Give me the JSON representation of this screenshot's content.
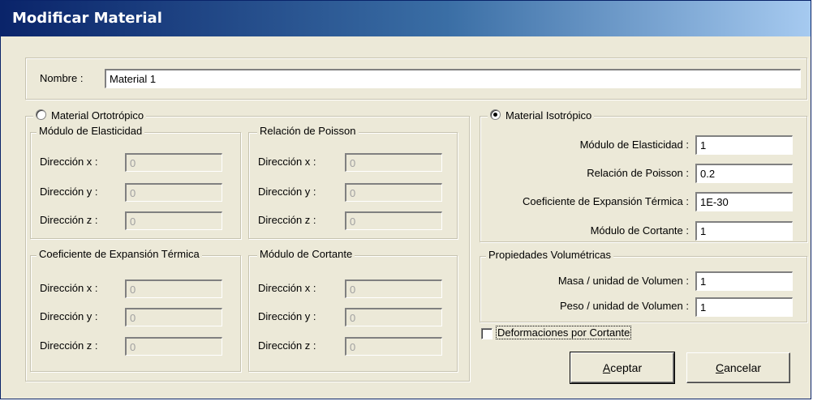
{
  "window": {
    "title": "Modificar Material"
  },
  "name": {
    "label": "Nombre :",
    "value": "Material 1"
  },
  "ortho": {
    "radio_label": "Material Ortotrópico",
    "selected": false,
    "modulus": {
      "title": "Módulo de Elasticidad",
      "x_label": "Dirección x :",
      "y_label": "Dirección y :",
      "z_label": "Dirección z :",
      "x": "0",
      "y": "0",
      "z": "0"
    },
    "poisson": {
      "title": "Relación de Poisson",
      "x_label": "Dirección x :",
      "y_label": "Dirección y :",
      "z_label": "Dirección z :",
      "x": "0",
      "y": "0",
      "z": "0"
    },
    "thermal": {
      "title": "Coeficiente de Expansión Térmica",
      "x_label": "Dirección x :",
      "y_label": "Dirección y :",
      "z_label": "Dirección z :",
      "x": "0",
      "y": "0",
      "z": "0"
    },
    "shear": {
      "title": "Módulo de Cortante",
      "x_label": "Dirección x :",
      "y_label": "Dirección y :",
      "z_label": "Dirección z :",
      "x": "0",
      "y": "0",
      "z": "0"
    }
  },
  "iso": {
    "radio_label": "Material Isotrópico",
    "selected": true,
    "modulus_label": "Módulo de Elasticidad :",
    "modulus": "1",
    "poisson_label": "Relación de Poisson :",
    "poisson": "0.2",
    "thermal_label": "Coeficiente de Expansión Térmica :",
    "thermal": "1E-30",
    "shear_label": "Módulo de Cortante :",
    "shear": "1"
  },
  "volumetric": {
    "title": "Propiedades Volumétricas",
    "mass_label": "Masa / unidad de Volumen :",
    "mass": "1",
    "weight_label": "Peso / unidad de Volumen :",
    "weight": "1"
  },
  "shear_deformation": {
    "label": "Deformaciones por Cortante",
    "checked": false
  },
  "buttons": {
    "accept_ul": "A",
    "accept_rest": "ceptar",
    "cancel_ul": "C",
    "cancel_rest": "ancelar"
  }
}
